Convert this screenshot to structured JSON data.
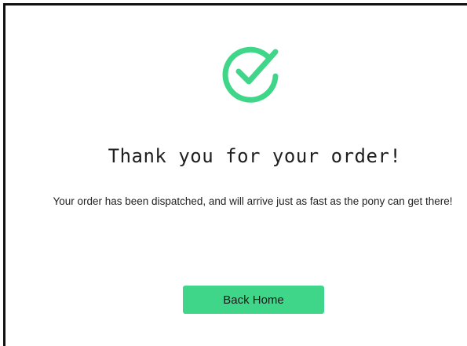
{
  "confirmation": {
    "icon": "check-circle-icon",
    "title": "Thank you for your order!",
    "message": "Your order has been dispatched, and will arrive just as fast as the pony can get there!",
    "back_home_label": "Back Home"
  },
  "colors": {
    "accent": "#3fd68a",
    "text": "#1f1f1f",
    "border": "#111111"
  }
}
